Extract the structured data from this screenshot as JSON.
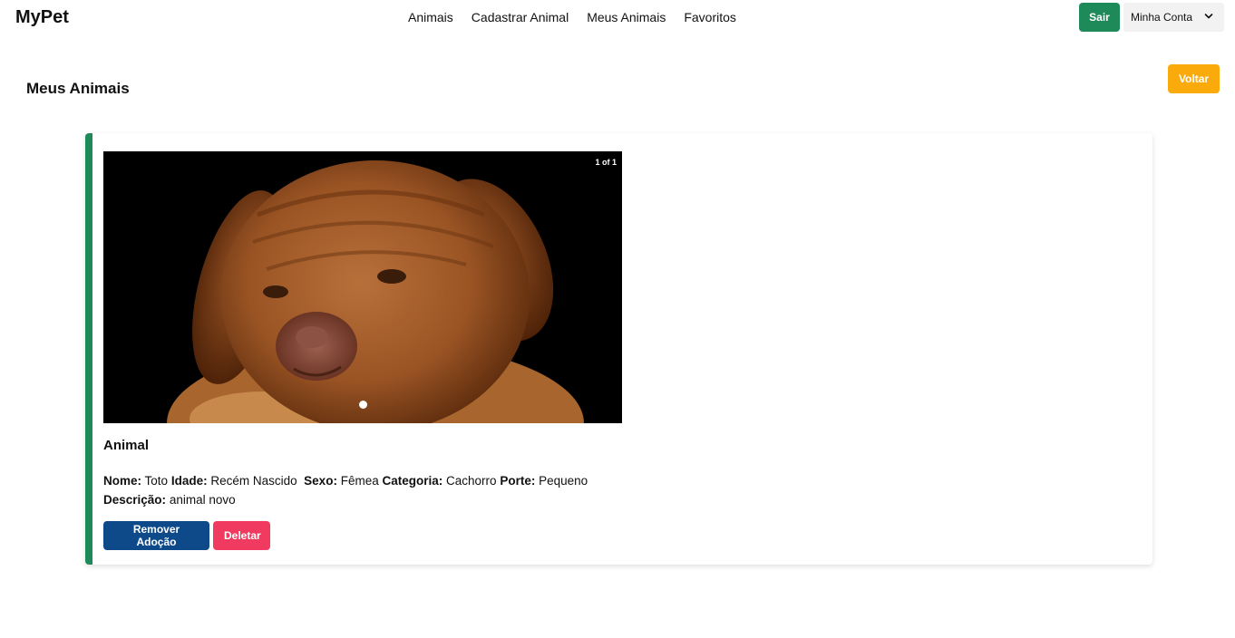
{
  "navbar": {
    "brand": "MyPet",
    "links": [
      "Animais",
      "Cadastrar Animal",
      "Meus Animais",
      "Favoritos"
    ],
    "logout_label": "Sair",
    "account_label": "Minha Conta"
  },
  "page": {
    "title": "Meus Animais",
    "back_label": "Voltar"
  },
  "card": {
    "carousel_counter": "1 of 1",
    "heading": "Animal",
    "fields": {
      "nome_label": "Nome:",
      "nome_value": "Toto",
      "idade_label": "Idade:",
      "idade_value": "Recém Nascido",
      "sexo_label": "Sexo:",
      "sexo_value": "Fêmea",
      "categoria_label": "Categoria:",
      "categoria_value": "Cachorro",
      "porte_label": "Porte:",
      "porte_value": "Pequeno",
      "descricao_label": "Descrição:",
      "descricao_value": "animal novo"
    },
    "remove_adoption_label": "Remover Adoção",
    "delete_label": "Deletar"
  },
  "colors": {
    "accent_green": "#1e8a5a",
    "voltar_orange": "#fbaa0b",
    "remover_blue": "#0e4a8a",
    "deletar_pink": "#f03a5f"
  }
}
